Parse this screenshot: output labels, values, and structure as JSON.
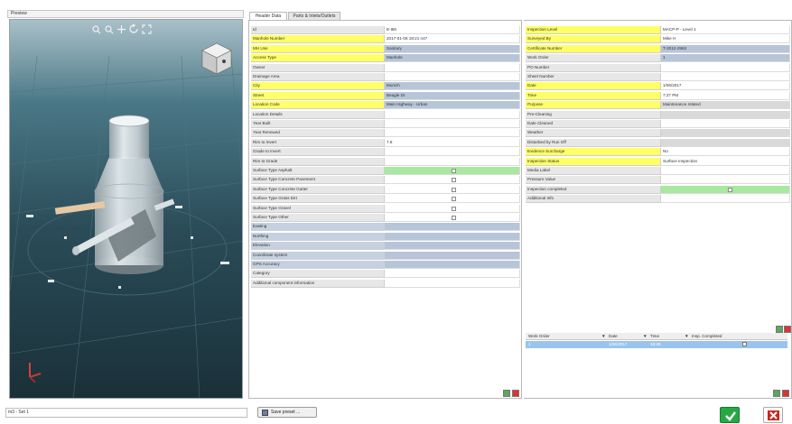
{
  "preview": {
    "title": "Preview",
    "viewport_bg": "#1f3d48",
    "tools": [
      "zoom-extents-icon",
      "zoom-icon",
      "pan-icon",
      "rotate-icon",
      "fit-icon"
    ]
  },
  "tabs": [
    {
      "label": "Header Data",
      "active": true
    },
    {
      "label": "Parts & Inlets/Outlets",
      "active": false
    }
  ],
  "left_rows": [
    {
      "label": "Id",
      "value": "E-I56",
      "type": "normal",
      "val": "white"
    },
    {
      "label": "Manhole Number",
      "value": "2017-01-06 18:21 n47",
      "type": "req",
      "val": "white"
    },
    {
      "label": "MH Use",
      "value": "Sanitary",
      "type": "req",
      "val": "blue"
    },
    {
      "label": "Access Type",
      "value": "Manhole",
      "type": "req",
      "val": "blue"
    },
    {
      "label": "Owner",
      "value": "",
      "type": "normal",
      "val": "white"
    },
    {
      "label": "Drainage Area",
      "value": "",
      "type": "normal",
      "val": "white"
    },
    {
      "label": "City",
      "value": "Munich",
      "type": "req",
      "val": "blue"
    },
    {
      "label": "Street",
      "value": "Beagle Dr.",
      "type": "req",
      "val": "blue"
    },
    {
      "label": "Location Code",
      "value": "Main Highway - Urban",
      "type": "req",
      "val": "blue"
    },
    {
      "label": "Location Details",
      "value": "",
      "type": "normal",
      "val": "white"
    },
    {
      "label": "Year Built",
      "value": "",
      "type": "normal",
      "val": "white"
    },
    {
      "label": "Year Renewed",
      "value": "",
      "type": "normal",
      "val": "white"
    },
    {
      "label": "Rim to Invert",
      "value": "7.8",
      "type": "normal",
      "val": "white"
    },
    {
      "label": "Grade to Invert",
      "value": "",
      "type": "normal",
      "val": "white"
    },
    {
      "label": "Rim to Grade",
      "value": "",
      "type": "normal",
      "val": "white"
    },
    {
      "label": "Surface Type Asphalt",
      "value": "",
      "type": "normal",
      "val": "green",
      "check": true
    },
    {
      "label": "Surface Type Concrete Pavement",
      "value": "",
      "type": "normal",
      "val": "white",
      "check": true
    },
    {
      "label": "Surface Type Concrete Gutter",
      "value": "",
      "type": "normal",
      "val": "white",
      "check": true
    },
    {
      "label": "Surface Type Grass Dirt",
      "value": "",
      "type": "normal",
      "val": "white",
      "check": true
    },
    {
      "label": "Surface Type Gravel",
      "value": "",
      "type": "normal",
      "val": "white",
      "check": true
    },
    {
      "label": "Surface Type Other",
      "value": "",
      "type": "normal",
      "val": "white",
      "check": true
    },
    {
      "label": "Easting",
      "value": "",
      "type": "blue",
      "val": "blue"
    },
    {
      "label": "Northing",
      "value": "",
      "type": "blue",
      "val": "blue"
    },
    {
      "label": "Elevation",
      "value": "",
      "type": "blue",
      "val": "blue"
    },
    {
      "label": "Coordinate system",
      "value": "",
      "type": "blue",
      "val": "blue"
    },
    {
      "label": "GPS Accuracy",
      "value": "",
      "type": "blue",
      "val": "blue"
    },
    {
      "label": "Category",
      "value": "",
      "type": "normal",
      "val": "white"
    },
    {
      "label": "Additional component information",
      "value": "",
      "type": "normal",
      "val": "white"
    }
  ],
  "right_rows": [
    {
      "label": "Inspection Level",
      "value": "MACP-P - Level 1",
      "type": "req",
      "val": "white"
    },
    {
      "label": "Surveyed By",
      "value": "Mike H",
      "type": "req",
      "val": "white"
    },
    {
      "label": "Certificate Number",
      "value": "T-2012-2963",
      "type": "req",
      "val": "blue"
    },
    {
      "label": "Work Order",
      "value": "1",
      "type": "normal",
      "val": "blue"
    },
    {
      "label": "PO Number",
      "value": "",
      "type": "normal",
      "val": "white"
    },
    {
      "label": "Sheet Number",
      "value": "",
      "type": "normal",
      "val": "white"
    },
    {
      "label": "Date",
      "value": "1/06/2017",
      "type": "req",
      "val": "white"
    },
    {
      "label": "Time",
      "value": "7:27 PM",
      "type": "req",
      "val": "white"
    },
    {
      "label": "Purpose",
      "value": "Maintenance related",
      "type": "req",
      "val": "grey"
    },
    {
      "label": "Pre-Cleaning",
      "value": "",
      "type": "normal",
      "val": "grey"
    },
    {
      "label": "Date Cleaned",
      "value": "",
      "type": "normal",
      "val": "white"
    },
    {
      "label": "Weather",
      "value": "",
      "type": "normal",
      "val": "grey"
    },
    {
      "label": "Disturbed by Run Off",
      "value": "",
      "type": "normal",
      "val": "grey"
    },
    {
      "label": "Evidence Surcharge",
      "value": "No",
      "type": "req",
      "val": "white"
    },
    {
      "label": "Inspection Status",
      "value": "Surface Inspection",
      "type": "req",
      "val": "white"
    },
    {
      "label": "Media Label",
      "value": "",
      "type": "normal",
      "val": "white"
    },
    {
      "label": "Pressure Value",
      "value": "",
      "type": "normal",
      "val": "white"
    },
    {
      "label": "Inspection completed",
      "value": "",
      "type": "normal",
      "val": "green",
      "check": true
    },
    {
      "label": "Additional Info",
      "value": "",
      "type": "normal",
      "val": "white"
    }
  ],
  "work_orders": {
    "headers": [
      "Work Order",
      "Date",
      "Time",
      "Insp. Completed"
    ],
    "rows": [
      {
        "order": "1",
        "date": "1/06/2017",
        "time": "19:26"
      }
    ]
  },
  "footer": {
    "status_value": "m3 - Set 1",
    "save_preset_label": "Save preset ...",
    "ok_color": "#27a844",
    "cancel_color": "#c9281e"
  }
}
